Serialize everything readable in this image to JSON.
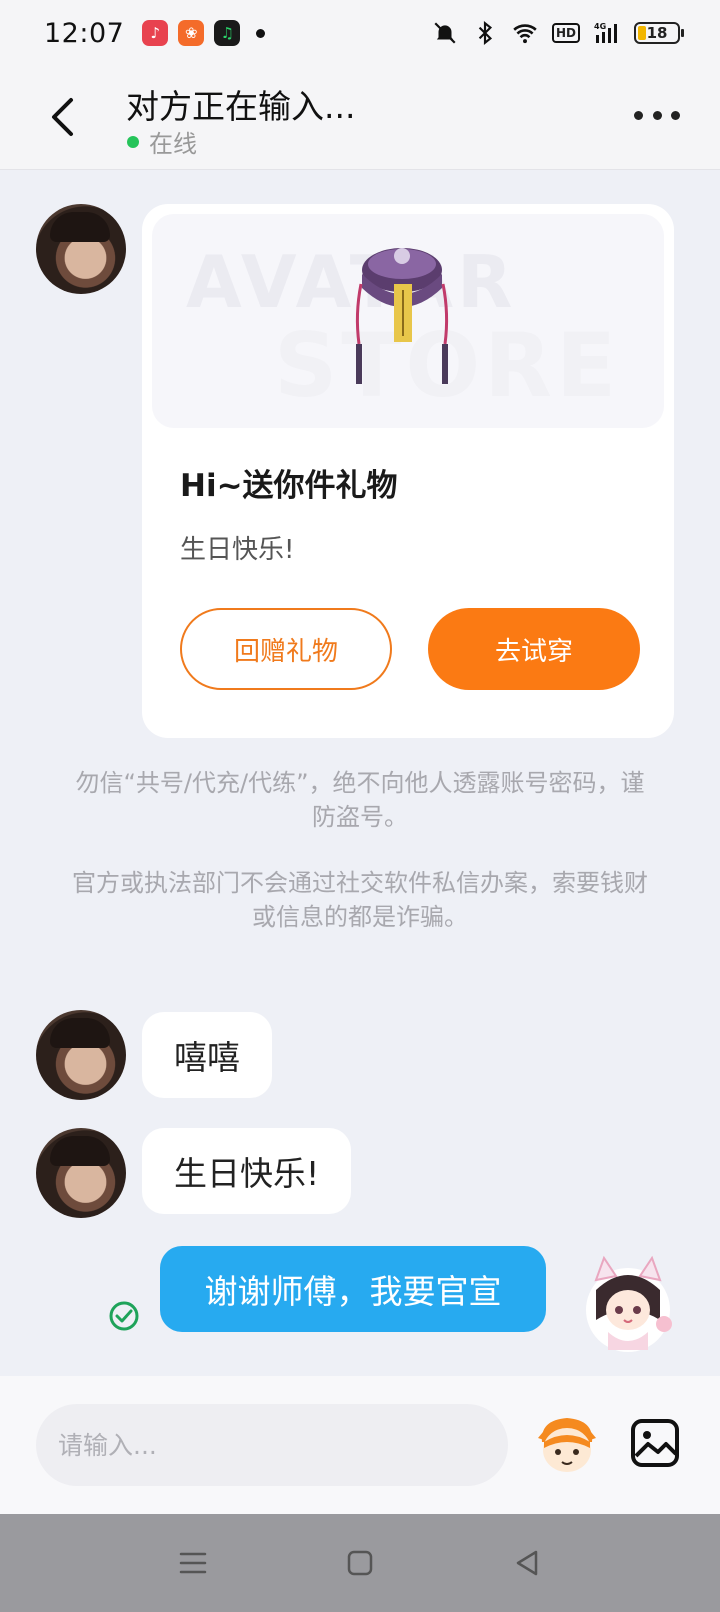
{
  "status_bar": {
    "time": "12:07",
    "battery": "18",
    "apps": [
      {
        "name": "music-app-icon",
        "color": "#e8424f"
      },
      {
        "name": "multi-app-icon",
        "color": "#f46b2a"
      },
      {
        "name": "qq-music-app-icon",
        "color": "#1ebc62"
      }
    ],
    "network_label": "HD",
    "signal_label": "4G"
  },
  "header": {
    "title": "对方正在输入...",
    "status": "在线"
  },
  "gift_card": {
    "watermark_line1": "AVATAR",
    "watermark_line2": "STORE",
    "title": "Hi~送你件礼物",
    "message": "生日快乐!",
    "return_button": "回赠礼物",
    "try_button": "去试穿"
  },
  "notices": [
    "勿信“共号/代充/代练”，绝不向他人透露账号密码，谨防盗号。",
    "官方或执法部门不会通过社交软件私信办案，索要钱财或信息的都是诈骗。"
  ],
  "messages": [
    {
      "side": "left",
      "text": "嘻嘻"
    },
    {
      "side": "left",
      "text": "生日快乐!"
    },
    {
      "side": "right",
      "text": "谢谢师傅，我要官宣"
    }
  ],
  "input": {
    "placeholder": "请输入..."
  },
  "colors": {
    "accent_orange": "#fb7a13",
    "bubble_blue": "#27aaf0",
    "online_green": "#25c45a"
  }
}
